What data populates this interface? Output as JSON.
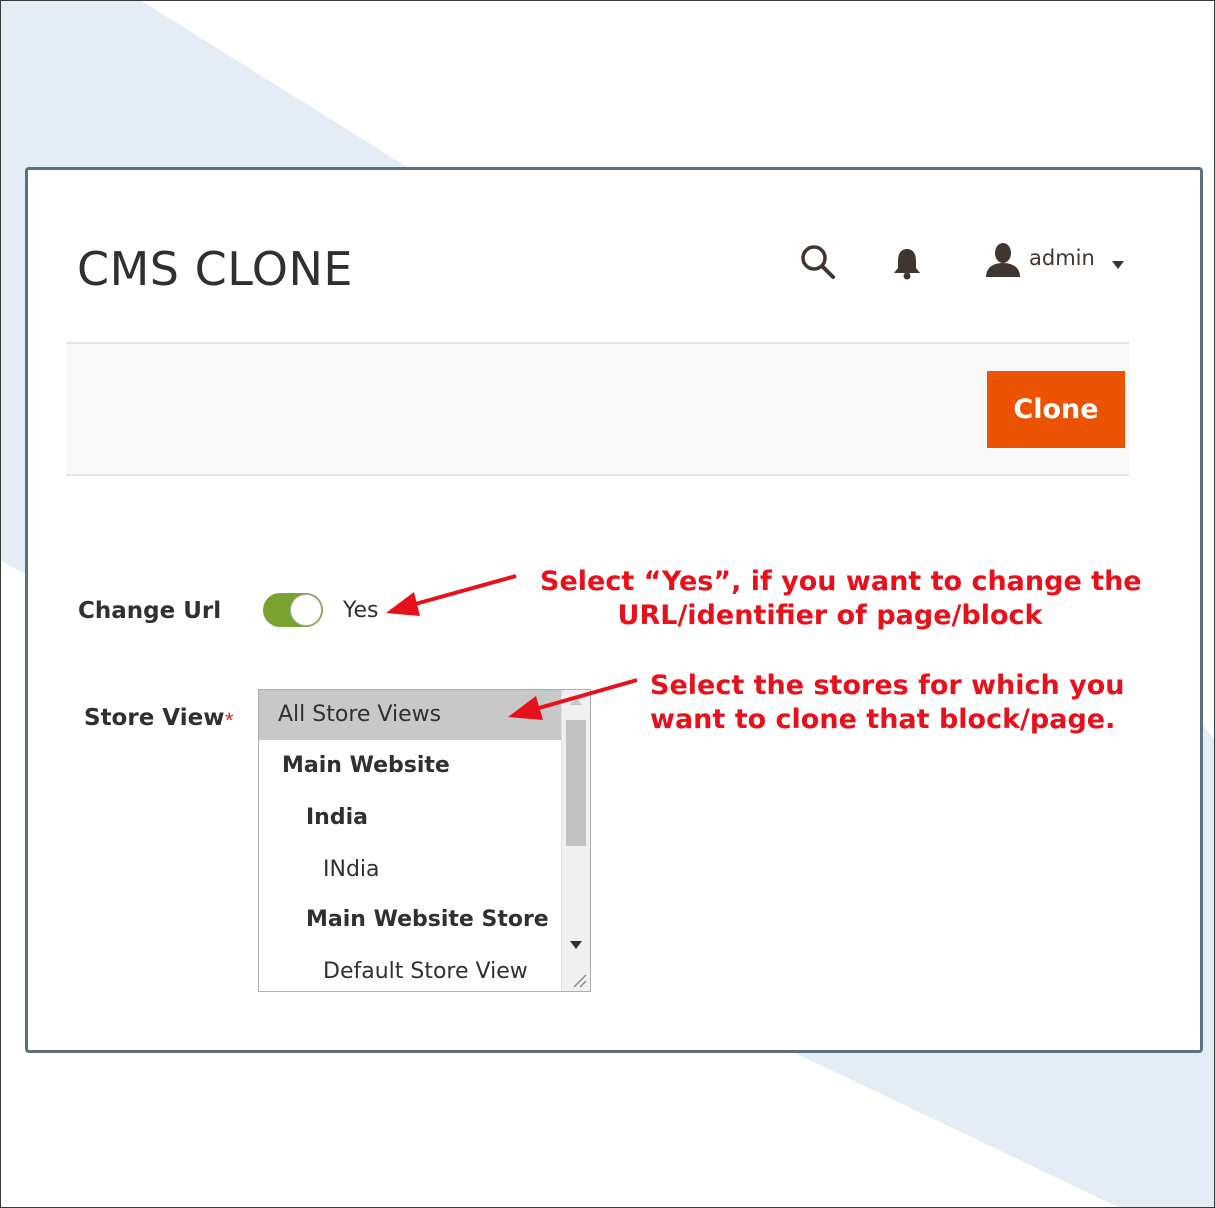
{
  "page": {
    "title": "CMS CLONE"
  },
  "header": {
    "user_name": "admin",
    "icons": {
      "search": "search-icon",
      "notifications": "bell-icon",
      "user": "user-icon",
      "caret": "chevron-down-icon"
    }
  },
  "actions": {
    "clone_label": "Clone",
    "clone_color": "#eb5202"
  },
  "form": {
    "change_url": {
      "label": "Change Url",
      "value": "Yes",
      "enabled": true,
      "toggle_color": "#79a22e"
    },
    "store_view": {
      "label": "Store View",
      "required_mark": "*",
      "options": [
        {
          "label": "All Store Views",
          "selected": true
        },
        {
          "label": "Main Website",
          "bold": true
        },
        {
          "label": "India",
          "bold": true
        },
        {
          "label": "INdia"
        },
        {
          "label": "Main Website Store",
          "bold": true
        },
        {
          "label": "Default Store View"
        }
      ]
    }
  },
  "annotations": {
    "change_url_line1": "Select “Yes”,  if you want to change the",
    "change_url_line2": "URL/identifier of page/block",
    "store_view_line1": "Select the stores for which you",
    "store_view_line2": "want to clone that block/page.",
    "color": "#e8101a"
  }
}
